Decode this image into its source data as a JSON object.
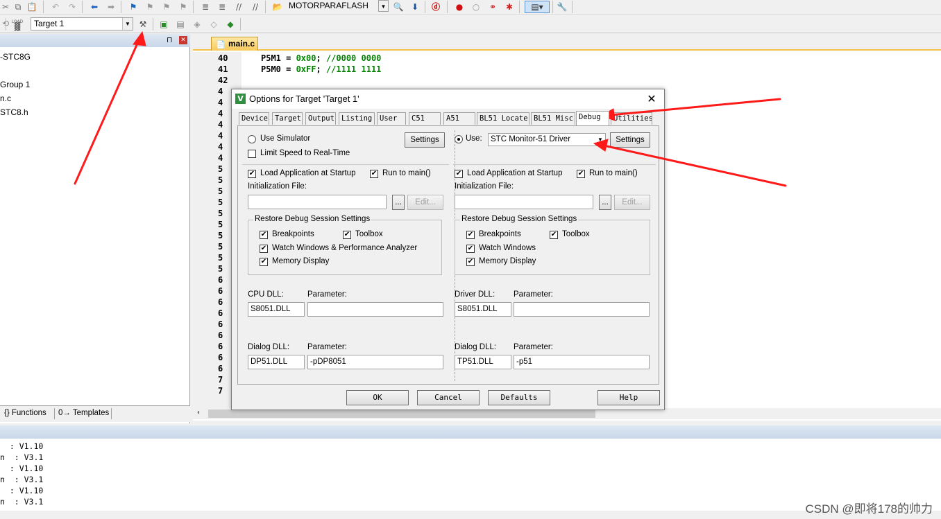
{
  "toolbar1": {
    "target_combo": "MOTORPARAFLASH"
  },
  "toolbar2": {
    "load_label": "LOAD",
    "target_select": "Target 1"
  },
  "project": {
    "pin_icon": "pin-icon",
    "items": [
      "-STC8G",
      "Group 1",
      "n.c",
      "STC8.h"
    ],
    "tabs": [
      "{} Functions",
      "0→ Templates"
    ]
  },
  "editor": {
    "file_tab": "main.c",
    "lines": [
      {
        "num": "40",
        "code": "P5M1 = 0x00; //0000 0000"
      },
      {
        "num": "41",
        "code": "P5M0 = 0xFF; //1111 1111"
      },
      {
        "num": "42",
        "code": ""
      }
    ],
    "partial_numbers": [
      "4",
      "4",
      "4",
      "4",
      "4",
      "4",
      "4",
      "5",
      "5",
      "5",
      "5",
      "5",
      "5",
      "5",
      "5",
      "5",
      "5",
      "6",
      "6",
      "6",
      "6",
      "6",
      "6",
      "6",
      "6",
      "6",
      "7",
      "7"
    ]
  },
  "output": {
    "lines": [
      "  : V1.10",
      "n  : V3.1",
      "  : V1.10",
      "n  : V3.1",
      "  : V1.10",
      "n  : V3.1"
    ]
  },
  "dialog": {
    "title": "Options for Target 'Target 1'",
    "tabs": [
      "Device",
      "Target",
      "Output",
      "Listing",
      "User",
      "C51",
      "A51",
      "BL51 Locate",
      "BL51 Misc",
      "Debug",
      "Utilities"
    ],
    "active_tab": "Debug",
    "left": {
      "use_simulator": "Use Simulator",
      "limit_speed": "Limit Speed to Real-Time",
      "settings": "Settings",
      "load_app": "Load Application at Startup",
      "run_to_main": "Run to main()",
      "init_file_label": "Initialization File:",
      "init_file_value": "",
      "browse": "...",
      "edit": "Edit...",
      "restore_group": "Restore Debug Session Settings",
      "breakpoints": "Breakpoints",
      "toolbox": "Toolbox",
      "watch": "Watch Windows & Performance Analyzer",
      "memory": "Memory Display",
      "cpu_dll_label": "CPU DLL:",
      "cpu_dll_value": "S8051.DLL",
      "param_label": "Parameter:",
      "cpu_param_value": "",
      "dialog_dll_label": "Dialog DLL:",
      "dialog_dll_value": "DP51.DLL",
      "dialog_param_value": "-pDP8051"
    },
    "right": {
      "use_label": "Use:",
      "driver_value": "STC Monitor-51 Driver",
      "settings": "Settings",
      "load_app": "Load Application at Startup",
      "run_to_main": "Run to main()",
      "init_file_label": "Initialization File:",
      "init_file_value": "",
      "browse": "...",
      "edit": "Edit...",
      "restore_group": "Restore Debug Session Settings",
      "breakpoints": "Breakpoints",
      "toolbox": "Toolbox",
      "watch": "Watch Windows",
      "memory": "Memory Display",
      "driver_dll_label": "Driver DLL:",
      "driver_dll_value": "S8051.DLL",
      "param_label": "Parameter:",
      "driver_param_value": "",
      "dialog_dll_label": "Dialog DLL:",
      "dialog_dll_value": "TP51.DLL",
      "dialog_param_value": "-p51"
    },
    "buttons": {
      "ok": "OK",
      "cancel": "Cancel",
      "defaults": "Defaults",
      "help": "Help"
    }
  },
  "watermark": "CSDN @即将178的帅力",
  "colors": {
    "annotation_arrow": "#ff1a1a",
    "code_number": "#008000",
    "code_comment": "#007f00"
  }
}
